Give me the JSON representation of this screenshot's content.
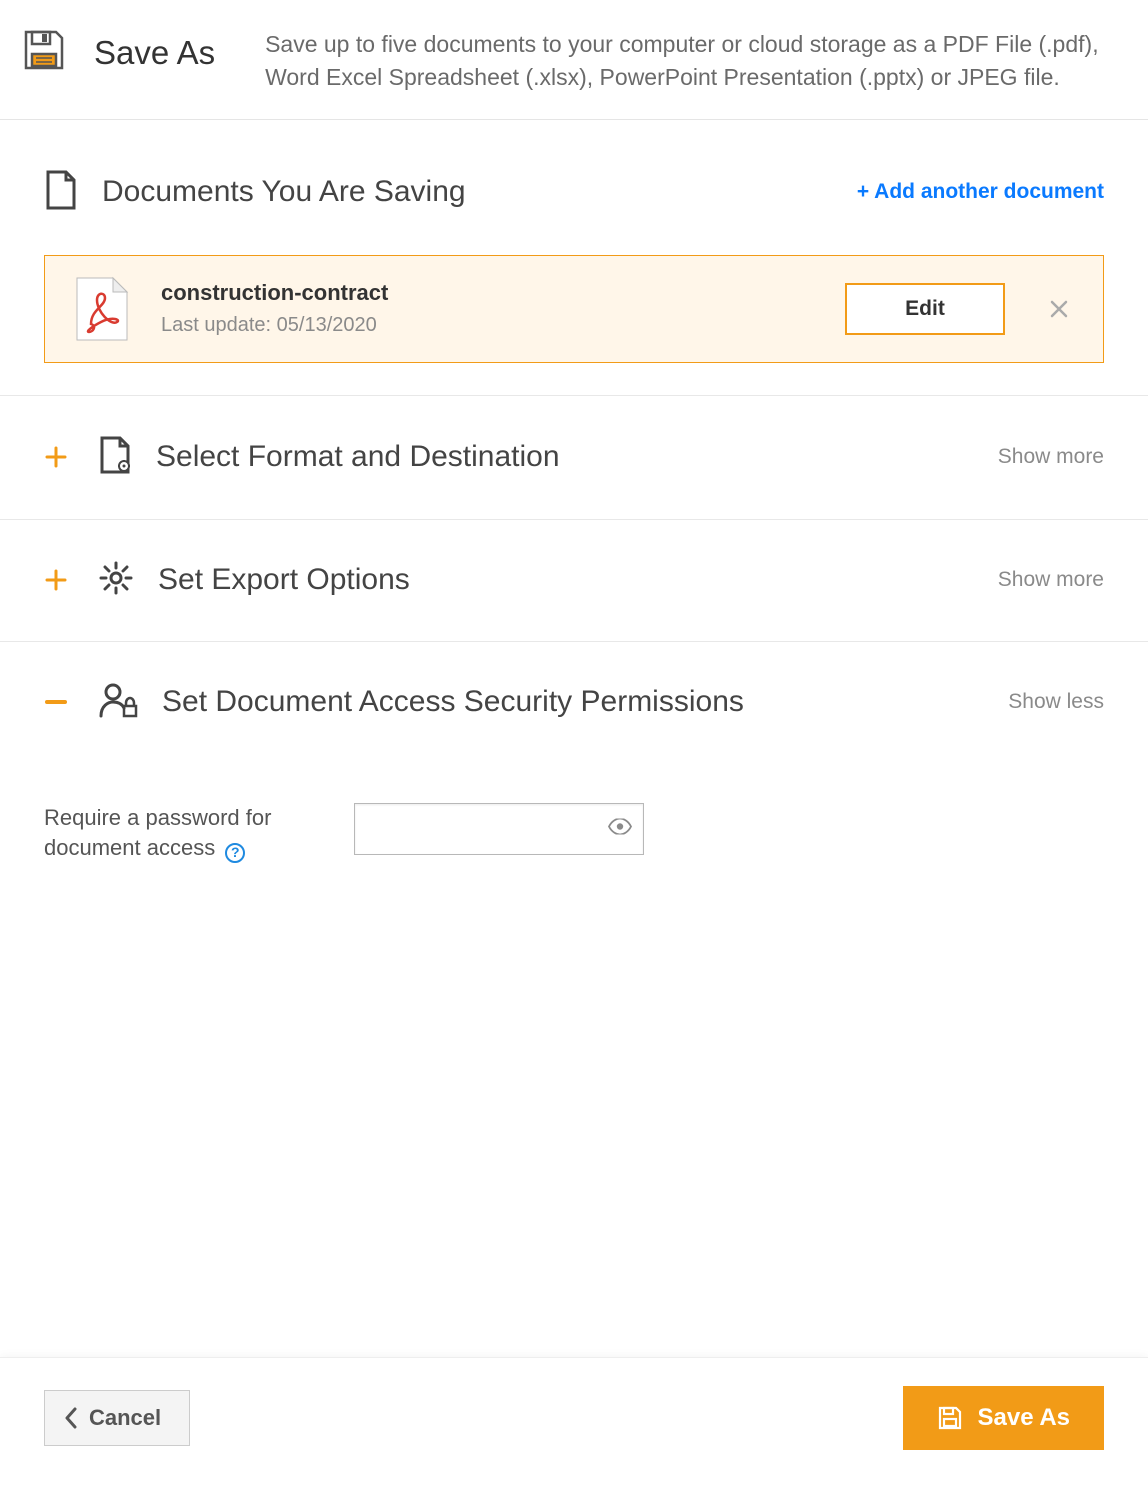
{
  "header": {
    "title": "Save As",
    "description": "Save up to five documents to your computer or cloud storage as a PDF File (.pdf), Word Excel Spreadsheet (.xlsx), PowerPoint Presentation (.pptx) or JPEG file."
  },
  "documents_section": {
    "title": "Documents You Are Saving",
    "add_label": "+ Add another document",
    "documents": [
      {
        "name": "construction-contract",
        "meta": "Last update: 05/13/2020",
        "edit_label": "Edit"
      }
    ]
  },
  "sections": {
    "format": {
      "title": "Select Format and Destination",
      "toggle": "Show more"
    },
    "export": {
      "title": "Set Export Options",
      "toggle": "Show more"
    },
    "security": {
      "title": "Set Document Access Security Permissions",
      "toggle": "Show less"
    }
  },
  "security_form": {
    "password_label": "Require a password for document access",
    "password_value": ""
  },
  "footer": {
    "cancel_label": "Cancel",
    "saveas_label": "Save As"
  },
  "colors": {
    "accent": "#f29b17",
    "link": "#0a7aff",
    "text": "#333",
    "muted": "#8a8a8a"
  }
}
